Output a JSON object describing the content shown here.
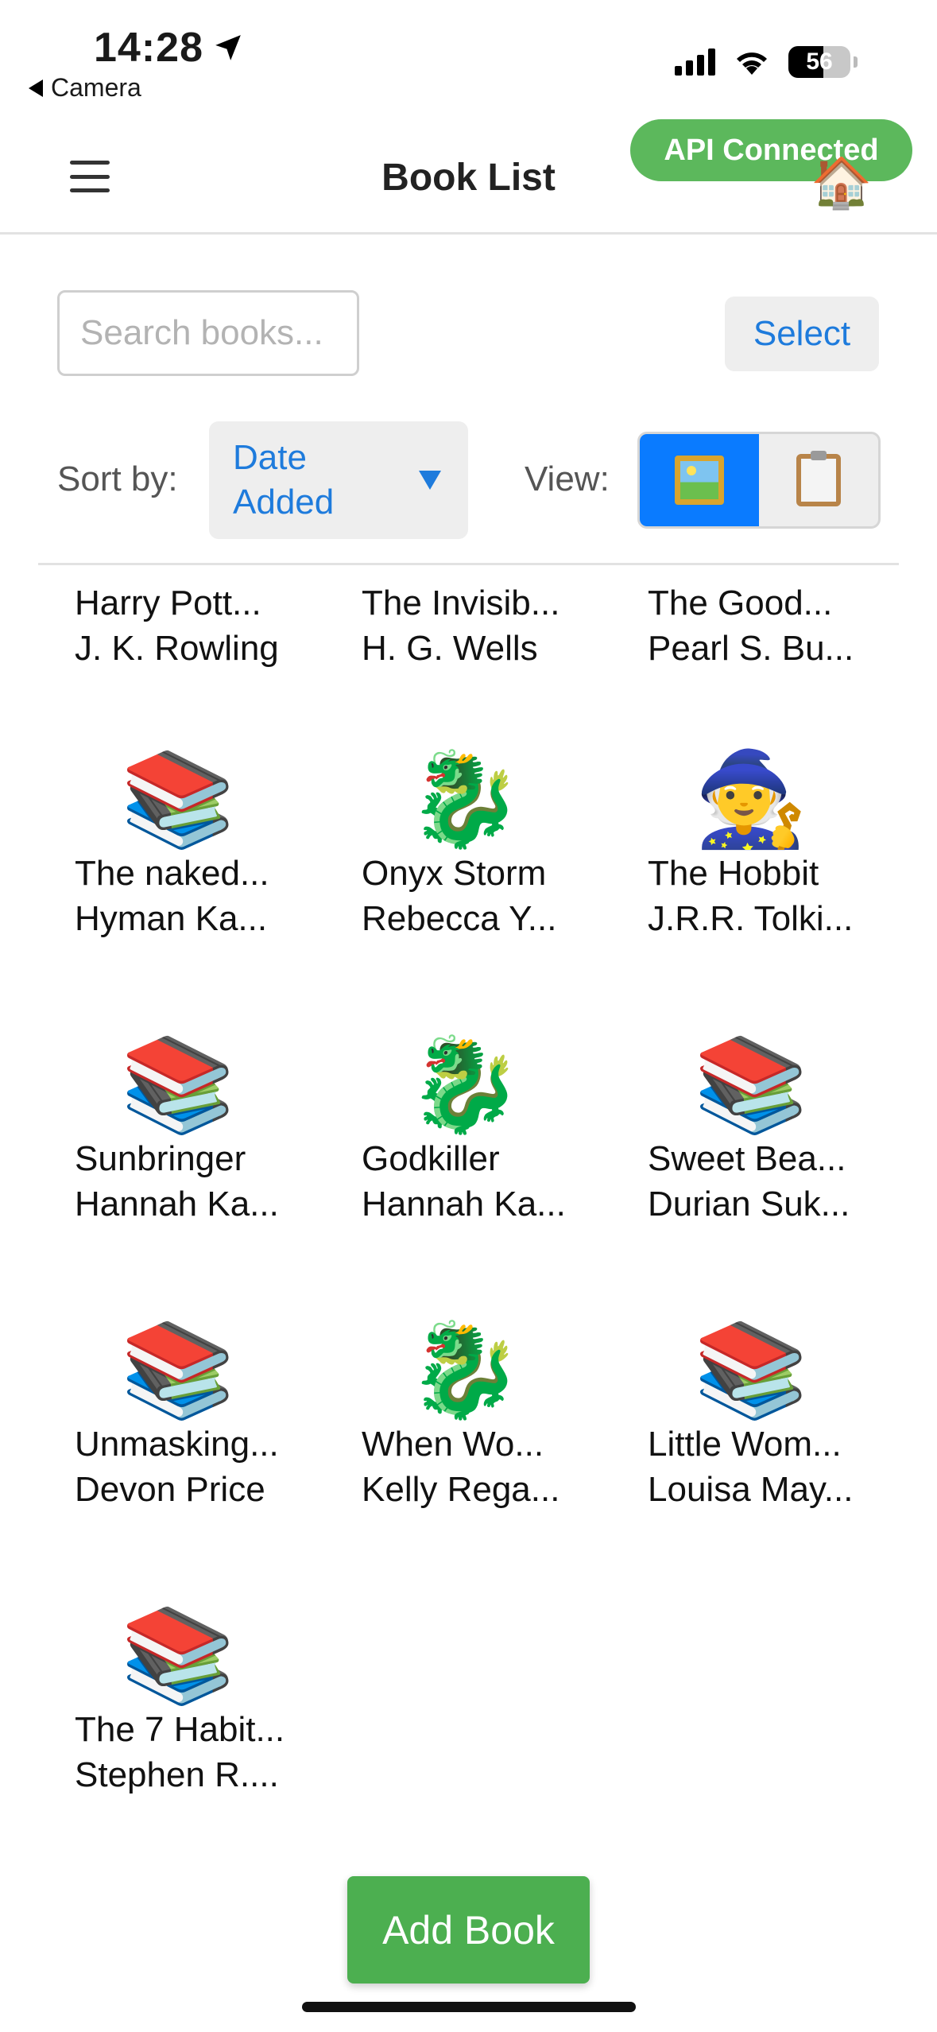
{
  "status_bar": {
    "time": "14:28",
    "back_app": "Camera",
    "battery": "56",
    "icons": [
      "location-arrow-icon",
      "cellular-signal-icon",
      "wifi-icon",
      "battery-icon"
    ]
  },
  "header": {
    "title": "Book List",
    "api_status": "API Connected",
    "house_icon": "🏠",
    "menu_icon": "hamburger-menu-icon"
  },
  "controls": {
    "search_placeholder": "Search books...",
    "search_value": "",
    "select_label": "Select",
    "sort_label": "Sort by:",
    "sort_value": "Date Added",
    "view_label": "View:",
    "view_modes": [
      "framed-picture-icon",
      "clipboard-icon"
    ],
    "active_view": "framed-picture-icon"
  },
  "books": [
    {
      "title": "Harry Pott...",
      "author": "J. K. Rowling",
      "icon": ""
    },
    {
      "title": "The Invisib...",
      "author": "H. G. Wells",
      "icon": ""
    },
    {
      "title": "The Good...",
      "author": "Pearl S. Bu...",
      "icon": ""
    },
    {
      "title": "The naked...",
      "author": "Hyman Ka...",
      "icon": "📚"
    },
    {
      "title": "Onyx Storm",
      "author": "Rebecca Y...",
      "icon": "🐉"
    },
    {
      "title": "The Hobbit",
      "author": "J.R.R. Tolki...",
      "icon": "🧙"
    },
    {
      "title": "Sunbringer",
      "author": "Hannah Ka...",
      "icon": "📚"
    },
    {
      "title": "Godkiller",
      "author": "Hannah Ka...",
      "icon": "🐉"
    },
    {
      "title": "Sweet Bea...",
      "author": "Durian Suk...",
      "icon": "📚"
    },
    {
      "title": "Unmasking...",
      "author": "Devon Price",
      "icon": "📚"
    },
    {
      "title": "When Wo...",
      "author": "Kelly Rega...",
      "icon": "🐉"
    },
    {
      "title": "Little Wom...",
      "author": "Louisa May...",
      "icon": "📚"
    },
    {
      "title": "The 7 Habit...",
      "author": "Stephen R....",
      "icon": "📚"
    }
  ],
  "footer": {
    "add_label": "Add Book"
  },
  "colors": {
    "accent_blue": "#1e7bdc",
    "toggle_active": "#0a7bff",
    "api_green": "#5cb85c",
    "add_green": "#4caf50"
  }
}
